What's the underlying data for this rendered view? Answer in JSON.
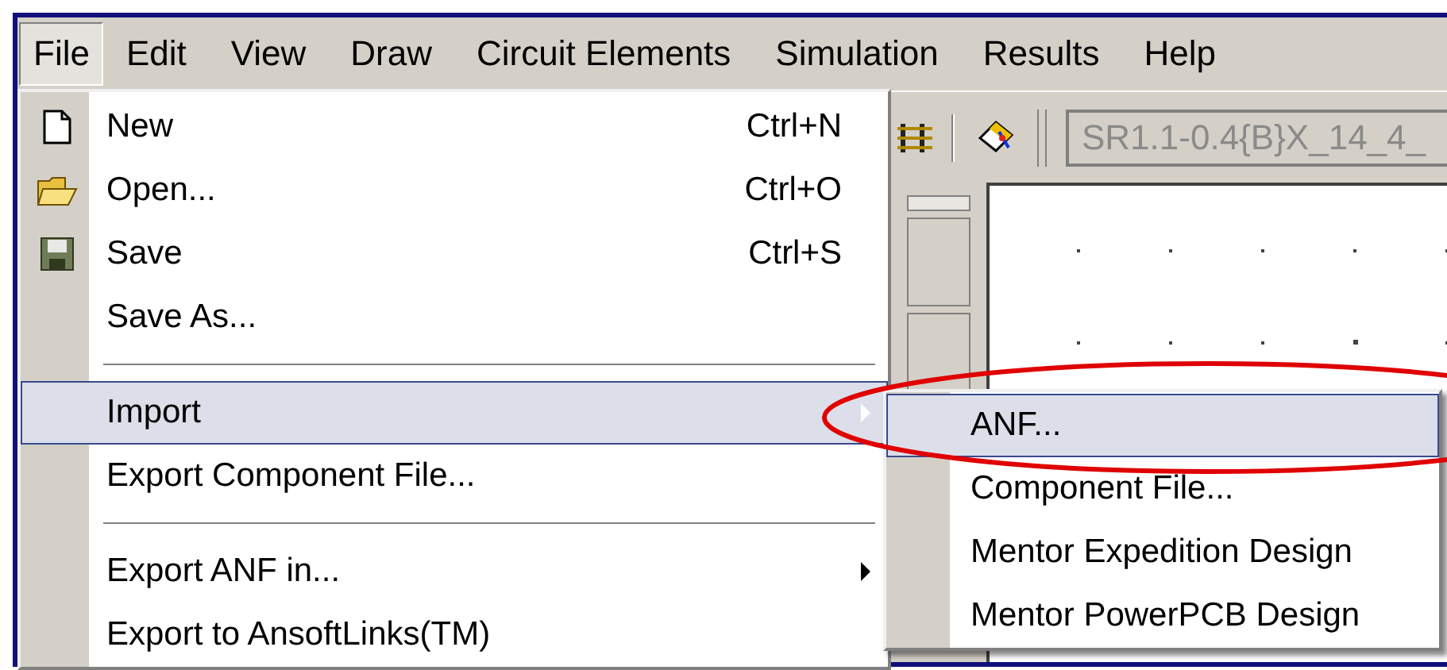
{
  "menu_bar": [
    {
      "label": "File",
      "selected": true
    },
    {
      "label": "Edit",
      "selected": false
    },
    {
      "label": "View",
      "selected": false
    },
    {
      "label": "Draw",
      "selected": false
    },
    {
      "label": "Circuit Elements",
      "selected": false
    },
    {
      "label": "Simulation",
      "selected": false
    },
    {
      "label": "Results",
      "selected": false
    },
    {
      "label": "Help",
      "selected": false
    }
  ],
  "toolbar": {
    "combo_value": "SR1.1-0.4{B}X_14_4_"
  },
  "file_menu": {
    "items": [
      {
        "kind": "item",
        "label": "New",
        "shortcut": "Ctrl+N",
        "selected": false,
        "submenu": false
      },
      {
        "kind": "item",
        "label": "Open...",
        "shortcut": "Ctrl+O",
        "selected": false,
        "submenu": false
      },
      {
        "kind": "item",
        "label": "Save",
        "shortcut": "Ctrl+S",
        "selected": false,
        "submenu": false
      },
      {
        "kind": "item",
        "label": "Save As...",
        "selected": false,
        "submenu": false
      },
      {
        "kind": "separator"
      },
      {
        "kind": "item",
        "label": "Import",
        "selected": true,
        "submenu": true
      },
      {
        "kind": "item",
        "label": "Export Component File...",
        "selected": false,
        "submenu": false
      },
      {
        "kind": "separator"
      },
      {
        "kind": "item",
        "label": "Export ANF in...",
        "selected": false,
        "submenu": true
      },
      {
        "kind": "item",
        "label": "Export to AnsoftLinks(TM)",
        "selected": false,
        "submenu": false
      }
    ]
  },
  "import_submenu": {
    "items": [
      {
        "label": "ANF...",
        "selected": true
      },
      {
        "label": "Component File...",
        "selected": false
      },
      {
        "label": "Mentor Expedition Design",
        "selected": false
      },
      {
        "label": "Mentor PowerPCB Design",
        "selected": false
      }
    ]
  },
  "annotation": {
    "kind": "ellipse"
  }
}
